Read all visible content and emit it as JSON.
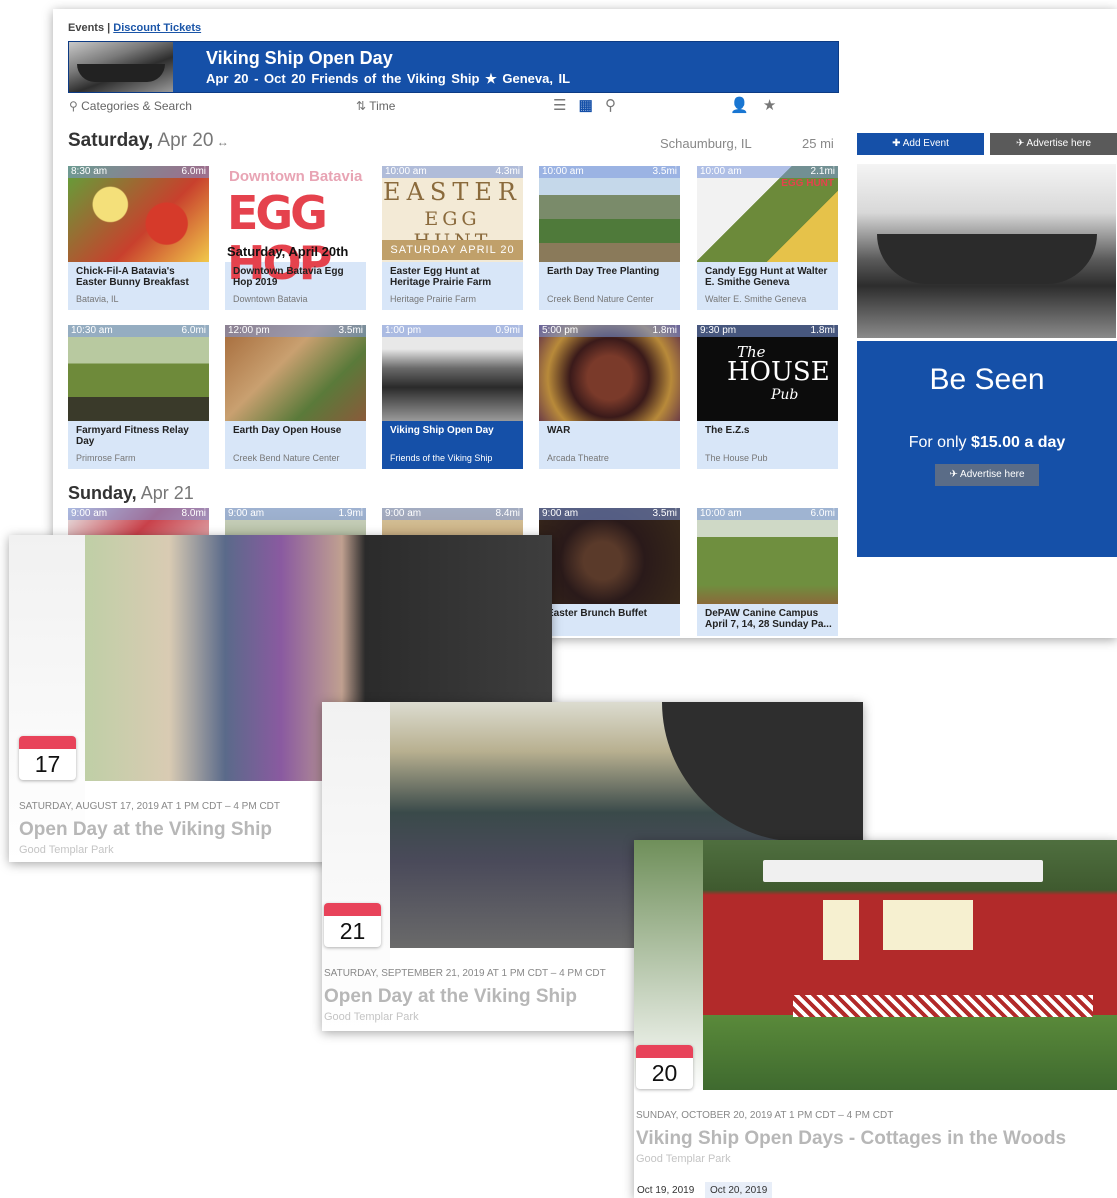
{
  "breadcrumb": {
    "events": "Events",
    "sep": "|",
    "discount": "Discount Tickets"
  },
  "banner": {
    "title": "Viking Ship Open Day",
    "subtitle": "Apr 20 - Oct 20   Friends of the Viking Ship   ★ Geneva, IL"
  },
  "toolbar": {
    "search_label": "Categories & Search",
    "time_label": "Time",
    "list_icon": "☰",
    "grid_icon": "▦",
    "map_icon": "⚲",
    "user_icon": "👤",
    "star_icon": "★",
    "search_icon": "⚲",
    "sort_icon": "⇅"
  },
  "location": {
    "city": "Schaumburg, IL",
    "radius": "25 mi"
  },
  "saturday": {
    "prefix": "Saturday,",
    "date": " Apr 20",
    "cards": [
      {
        "time": "8:30 am",
        "dist": "6.0mi",
        "name": "Chick-Fil-A Batavia's Easter Bunny Breakfast",
        "venue": "Batavia, IL"
      },
      {
        "time": "",
        "dist": "",
        "name": "Downtown Batavia Egg Hop 2019",
        "venue": "Downtown Batavia",
        "art_line1": "Downtown Batavia",
        "art_line2": "EGG HOP",
        "art_line3": "Saturday, April 20th"
      },
      {
        "time": "10:00 am",
        "dist": "4.3mi",
        "name": "Easter Egg Hunt at Heritage Prairie Farm",
        "venue": "Heritage Prairie Farm",
        "art_line1": "EASTER",
        "art_line2": "EGG HUNT",
        "art_line3": "SATURDAY APRIL 20"
      },
      {
        "time": "10:00 am",
        "dist": "3.5mi",
        "name": "Earth Day Tree Planting",
        "venue": "Creek Bend Nature Center"
      },
      {
        "time": "10:00 am",
        "dist": "2.1mi",
        "name": "Candy Egg Hunt at Walter E. Smithe Geneva",
        "venue": "Walter E. Smithe Geneva",
        "art_line1": "EGG HUNT"
      },
      {
        "time": "10:30 am",
        "dist": "6.0mi",
        "name": "Farmyard Fitness Relay Day",
        "venue": "Primrose Farm"
      },
      {
        "time": "12:00 pm",
        "dist": "3.5mi",
        "name": "Earth Day Open House",
        "venue": "Creek Bend Nature Center"
      },
      {
        "time": "1:00 pm",
        "dist": "0.9mi",
        "name": "Viking Ship Open Day",
        "venue": "Friends of the Viking Ship"
      },
      {
        "time": "5:00 pm",
        "dist": "1.8mi",
        "name": "WAR",
        "venue": "Arcada Theatre"
      },
      {
        "time": "9:30 pm",
        "dist": "1.8mi",
        "name": "The E.Z.s",
        "venue": "The House Pub",
        "art_line1": "The",
        "art_line2": "HOUSE",
        "art_line3": "Pub"
      }
    ]
  },
  "sunday": {
    "prefix": "Sunday,",
    "date": " Apr 21",
    "cards": [
      {
        "time": "9:00 am",
        "dist": "8.0mi",
        "name": "",
        "venue": ""
      },
      {
        "time": "9:00 am",
        "dist": "1.9mi",
        "name": "",
        "venue": ""
      },
      {
        "time": "9:00 am",
        "dist": "8.4mi",
        "name": "",
        "venue": ""
      },
      {
        "time": "9:00 am",
        "dist": "3.5mi",
        "name": "Easter Brunch Buffet",
        "venue": ""
      },
      {
        "time": "10:00 am",
        "dist": "6.0mi",
        "name": "DePAW Canine Campus April 7, 14, 28 Sunday Pa...",
        "venue": ""
      }
    ]
  },
  "sidebar": {
    "add_event": "✚ Add Event",
    "advertise": "✈ Advertise here",
    "be_seen": "Be Seen",
    "for_only": "For only ",
    "price": "$15.00 a day",
    "advertise_small": "✈ Advertise here"
  },
  "events": [
    {
      "day": "17",
      "date_line": "SATURDAY, AUGUST 17, 2019 AT 1 PM CDT – 4 PM CDT",
      "title": "Open Day at the Viking Ship",
      "venue": "Good Templar Park"
    },
    {
      "day": "21",
      "date_line": "SATURDAY, SEPTEMBER 21, 2019 AT 1 PM CDT – 4 PM CDT",
      "title": "Open Day at the Viking Ship",
      "venue": "Good Templar Park"
    },
    {
      "day": "20",
      "date_line": "SUNDAY, OCTOBER 20, 2019 AT 1 PM CDT – 4 PM CDT",
      "title": "Viking Ship Open Days - Cottages in the Woods",
      "venue": "Good Templar Park",
      "chips": [
        "Oct 19, 2019",
        "Oct 20, 2019"
      ]
    }
  ],
  "colors": {
    "brand_blue": "#1550a8",
    "card_bg": "#d8e6f8",
    "calendar_red": "#e8435a"
  }
}
